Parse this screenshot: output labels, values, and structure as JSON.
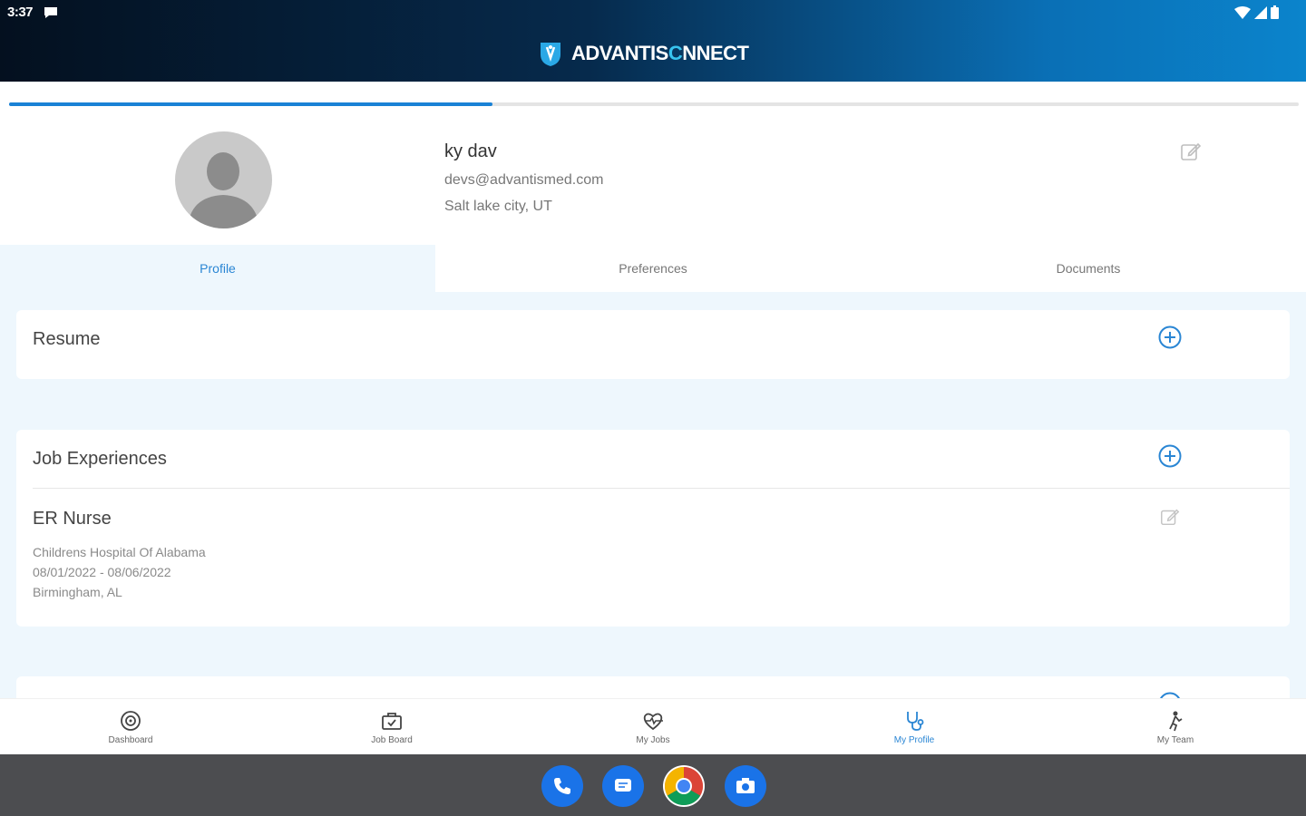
{
  "status_bar": {
    "time": "3:37"
  },
  "header": {
    "logo_part1": "ADVANTIS",
    "logo_accent": "C",
    "logo_part2": "NNECT"
  },
  "profile_progress": 0.375,
  "user": {
    "name": "ky dav",
    "email": "devs@advantismed.com",
    "location": "Salt lake city, UT"
  },
  "tabs": [
    {
      "label": "Profile",
      "active": true
    },
    {
      "label": "Preferences",
      "active": false
    },
    {
      "label": "Documents",
      "active": false
    }
  ],
  "sections": {
    "resume": {
      "title": "Resume"
    },
    "job_experiences": {
      "title": "Job Experiences",
      "items": [
        {
          "title": "ER Nurse",
          "facility": "Childrens Hospital Of Alabama",
          "dates": "08/01/2022 - 08/06/2022",
          "location": "Birmingham, AL"
        }
      ]
    }
  },
  "bottom_nav": [
    {
      "label": "Dashboard",
      "icon": "dashboard-icon",
      "active": false
    },
    {
      "label": "Job Board",
      "icon": "briefcase-icon",
      "active": false
    },
    {
      "label": "My Jobs",
      "icon": "heart-pulse-icon",
      "active": false
    },
    {
      "label": "My Profile",
      "icon": "stethoscope-icon",
      "active": true
    },
    {
      "label": "My Team",
      "icon": "person-team-icon",
      "active": false
    }
  ],
  "dock": [
    {
      "icon": "phone-app-icon",
      "color": "#1a73e8"
    },
    {
      "icon": "messages-app-icon",
      "color": "#1a73e8"
    },
    {
      "icon": "chrome-app-icon",
      "color": "#ffffff"
    },
    {
      "icon": "camera-app-icon",
      "color": "#1a73e8"
    }
  ],
  "colors": {
    "accent": "#2a86d4",
    "page_bg": "#eef7fd",
    "header_dark": "#04101f",
    "header_light": "#0b84cc",
    "logo_accent": "#38c4ef"
  }
}
